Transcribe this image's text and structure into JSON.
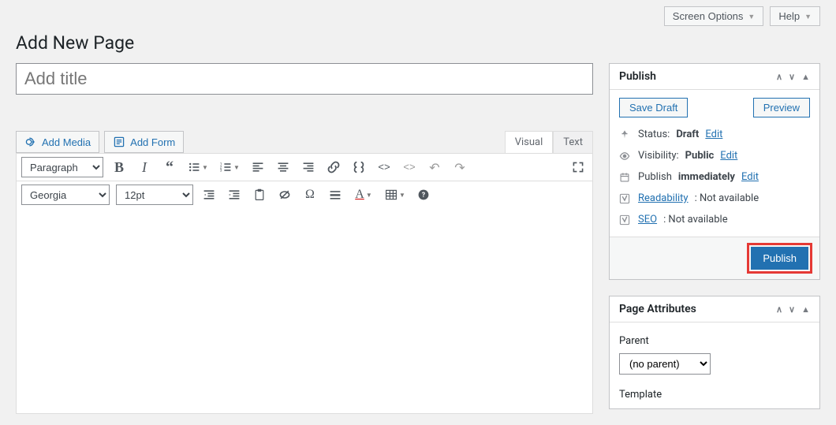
{
  "topbar": {
    "screen_options": "Screen Options",
    "help": "Help"
  },
  "heading": "Add New Page",
  "title_placeholder": "Add title",
  "media": {
    "add_media": "Add Media",
    "add_form": "Add Form"
  },
  "tabs": {
    "visual": "Visual",
    "text": "Text"
  },
  "toolbar": {
    "format": "Paragraph",
    "font": "Georgia",
    "size": "12pt"
  },
  "publish_box": {
    "title": "Publish",
    "save_draft": "Save Draft",
    "preview": "Preview",
    "status_label": "Status:",
    "status_value": "Draft",
    "visibility_label": "Visibility:",
    "visibility_value": "Public",
    "schedule_label": "Publish",
    "schedule_value": "immediately",
    "readability_label": "Readability",
    "readability_value": ": Not available",
    "seo_label": "SEO",
    "seo_value": ": Not available",
    "edit": "Edit",
    "publish_btn": "Publish"
  },
  "attributes_box": {
    "title": "Page Attributes",
    "parent_label": "Parent",
    "parent_value": "(no parent)",
    "template_label": "Template"
  }
}
